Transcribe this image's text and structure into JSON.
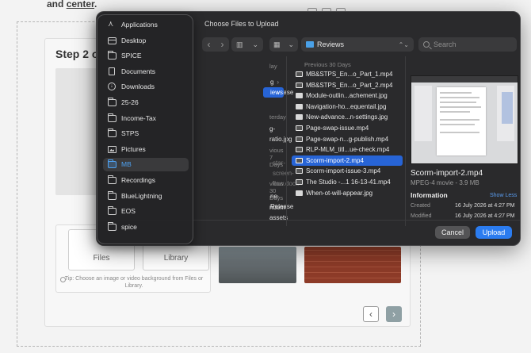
{
  "background_page": {
    "intro_text_1": "and",
    "intro_text_2": "center",
    "intro_text_3": ".",
    "step_title": "Step 2 o",
    "upload_tile_files": "Files",
    "upload_tile_library": "Library",
    "tip": "Tip: Choose an image or video background from Files or Library.",
    "prev_label": "‹",
    "next_label": "›"
  },
  "dialog": {
    "title": "Choose Files to Upload",
    "toolbar": {
      "back_glyph": "‹",
      "forward_glyph": "›",
      "view_glyph": "▥",
      "chevron": "⌄",
      "group_glyph": "▦",
      "location": "Reviews",
      "location_arrows": "⌃⌄",
      "search_placeholder": "Search"
    },
    "sidebar": [
      {
        "label": "Applications",
        "icon": "apps-icon"
      },
      {
        "label": "Desktop",
        "icon": "desktop-icon"
      },
      {
        "label": "SPICE",
        "icon": "folder-icon"
      },
      {
        "label": "Documents",
        "icon": "document-icon"
      },
      {
        "label": "Downloads",
        "icon": "downloads-icon"
      },
      {
        "label": "25-26",
        "icon": "folder-icon"
      },
      {
        "label": "Income-Tax",
        "icon": "folder-icon"
      },
      {
        "label": "STPS",
        "icon": "folder-icon"
      },
      {
        "label": "Pictures",
        "icon": "pictures-icon"
      },
      {
        "label": "MB",
        "icon": "folder-icon",
        "selected": true
      },
      {
        "label": "Recordings",
        "icon": "folder-icon"
      },
      {
        "label": "BlueLightning",
        "icon": "folder-icon"
      },
      {
        "label": "EOS",
        "icon": "folder-icon"
      },
      {
        "label": "spice",
        "icon": "folder-icon"
      }
    ],
    "column1": {
      "head_today": "lay",
      "item_release": "g Release",
      "item_reviews": "iews",
      "head_yesterday": "terday",
      "item_ratio": "g-ratio.jpg",
      "head_prev7": "vious 7 Days",
      "item_docx": "star-screen-flow.docx",
      "head_prev30": "vious 30 Days",
      "item_release2": "ne Release",
      "item_assets": "ndom-assets",
      "chevron": "›"
    },
    "column2": {
      "head": "Previous 30 Days",
      "files": [
        {
          "name": "MB&STPS_En...o_Part_1.mp4",
          "type": "video"
        },
        {
          "name": "MB&STPS_En...o_Part_2.mp4",
          "type": "video"
        },
        {
          "name": "Module-outlin...achement.jpg",
          "type": "image"
        },
        {
          "name": "Navigation-ho...equentail.jpg",
          "type": "image"
        },
        {
          "name": "New-advance...n-settings.jpg",
          "type": "image"
        },
        {
          "name": "Page-swap-issue.mp4",
          "type": "video"
        },
        {
          "name": "Page-swap-n...g-publish.mp4",
          "type": "video"
        },
        {
          "name": "RLP-MLM_titl...ue-check.mp4",
          "type": "video"
        },
        {
          "name": "Scorm-import-2.mp4",
          "type": "video",
          "selected": true
        },
        {
          "name": "Scorm-import-issue-3.mp4",
          "type": "video"
        },
        {
          "name": "The Studio -...1 16-13-41.mp4",
          "type": "video"
        },
        {
          "name": "When-ot-will-appear.jpg",
          "type": "image"
        }
      ]
    },
    "preview": {
      "filename": "Scorm-import-2.mp4",
      "kind": "MPEG-4 movie - 3.9 MB",
      "info_title": "Information",
      "show_less": "Show Less",
      "created_label": "Created",
      "created_value": "16 July 2026 at 4:27 PM",
      "modified_label": "Modified",
      "modified_value": "16 July 2026 at 4:27 PM"
    },
    "buttons": {
      "cancel": "Cancel",
      "upload": "Upload"
    }
  },
  "colors": {
    "accent": "#2764d6",
    "upload_button": "#2b7cf0",
    "sidebar_selected_text": "#4ea2f2"
  }
}
